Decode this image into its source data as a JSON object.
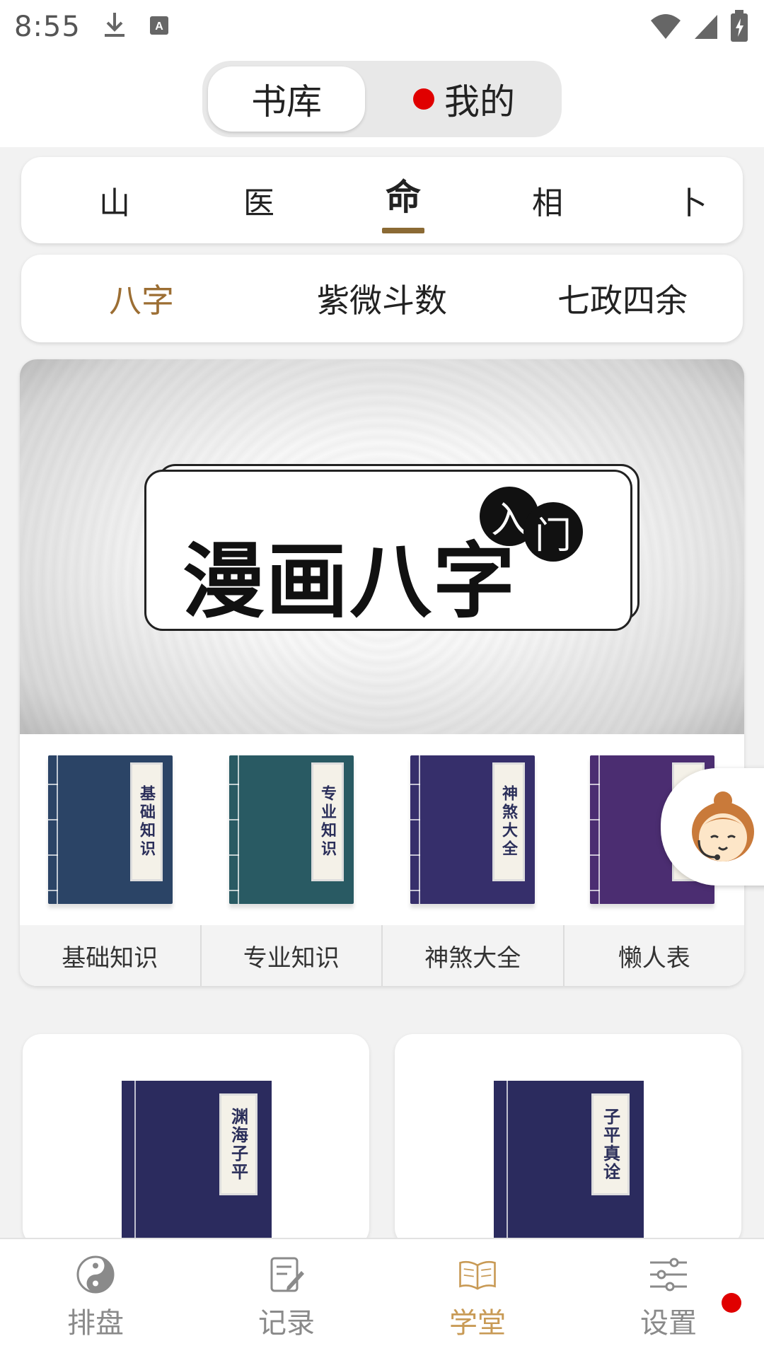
{
  "status_bar": {
    "time": "8:55",
    "icons_left": [
      "download-icon",
      "translate-icon"
    ],
    "icons_right": [
      "wifi-icon",
      "signal-icon",
      "battery-icon"
    ]
  },
  "header": {
    "tabs": [
      {
        "label": "书库",
        "selected": true
      },
      {
        "label": "我的",
        "selected": false,
        "has_dot": true
      }
    ]
  },
  "categories": {
    "items": [
      "山",
      "医",
      "命",
      "相",
      "卜"
    ],
    "selected": "命"
  },
  "subcategories": {
    "items": [
      "八字",
      "紫微斗数",
      "七政四余"
    ],
    "selected": "八字"
  },
  "banner": {
    "title": "漫画八字",
    "badge": [
      "入",
      "门"
    ]
  },
  "books": [
    {
      "label": "基础知识",
      "cover_text": "基础知识",
      "color": "#2b4466"
    },
    {
      "label": "专业知识",
      "cover_text": "专业知识",
      "color": "#295a63"
    },
    {
      "label": "神煞大全",
      "cover_text": "神煞大全",
      "color": "#362f6b"
    },
    {
      "label": "懒人表",
      "cover_text": "",
      "color": "#4b2d71"
    }
  ],
  "featured": [
    {
      "cover_text": "渊海子平"
    },
    {
      "cover_text": "子平真诠"
    }
  ],
  "bottom_nav": {
    "items": [
      {
        "label": "排盘",
        "icon": "yin-yang-icon",
        "active": false
      },
      {
        "label": "记录",
        "icon": "note-edit-icon",
        "active": false
      },
      {
        "label": "学堂",
        "icon": "open-book-icon",
        "active": true
      },
      {
        "label": "设置",
        "icon": "sliders-icon",
        "active": false,
        "has_dot": true
      }
    ]
  },
  "colors": {
    "accent": "#9c6e33",
    "red_dot": "#e00000"
  }
}
